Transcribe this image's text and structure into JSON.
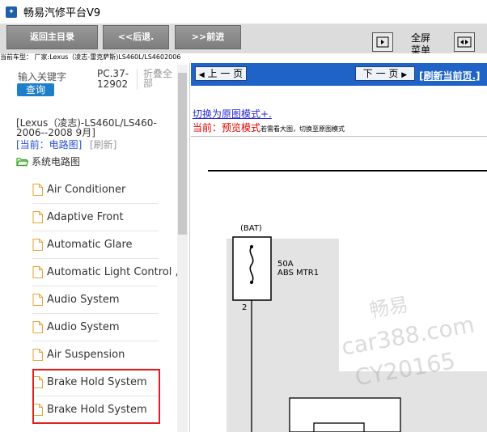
{
  "window": {
    "title": "畅易汽修平台V9"
  },
  "toolbar": {
    "home_label": "返回主目录",
    "back_label": "<<后退.",
    "forward_label": ">>前进",
    "fullscreen_line1": "全屏",
    "fullscreen_line2": "菜单"
  },
  "car_line": "当前车型：  厂家:Lexus（凌志-雷克萨斯)LS460L/LS4602006",
  "left": {
    "keyword_label": "输入关键字",
    "search_label": "查询",
    "pc_code": "PC.37-12902",
    "fold_all": "折叠全部",
    "model_info": "[Lexus（凌志)-LS460L/LS460-2006--2008 9月]",
    "current_label": "[当前：电路图]",
    "refresh_label": "[刷新]",
    "folder_label": "系统电路图",
    "items": [
      "Air Conditioner",
      "Adaptive Front",
      "Automatic Glare",
      "Automatic Light Control ,",
      "Audio System",
      "Audio System",
      "Air Suspension",
      "Brake Hold System",
      "Brake Hold System"
    ]
  },
  "right": {
    "prev_label": "上 一 页",
    "next_label": "下 一 页",
    "refresh_page_label": "[刷新当前页.]",
    "switch_mode_label": "切换为原图模式+.",
    "preview_current": "当前：预览模式",
    "preview_hint": "若需看大图，切换至原图模式",
    "diagram": {
      "bat_label": "(BAT)",
      "fuse_rating": "50A",
      "fuse_name": "ABS MTR1",
      "pin_number": "2"
    },
    "watermark": [
      "畅易",
      "car388.com",
      "CY20165"
    ]
  },
  "colors": {
    "nav_blue": "#1e63c5",
    "search_blue": "#1e7fc8",
    "highlight_red": "#e02020",
    "toolbar_gray": "#dcdcdc"
  }
}
